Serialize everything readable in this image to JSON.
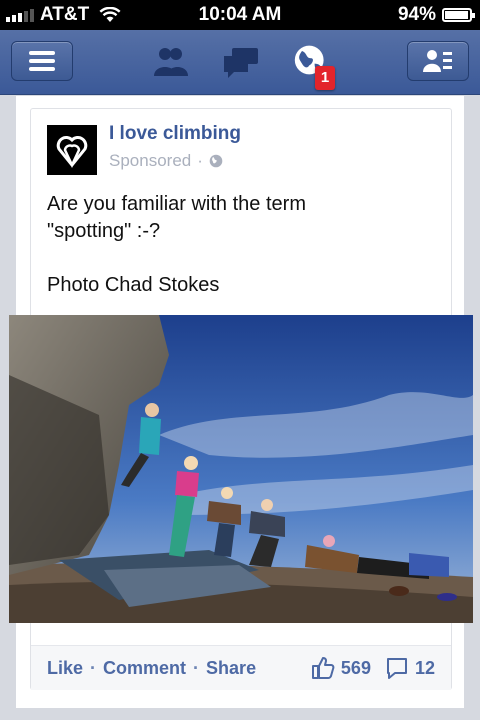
{
  "status": {
    "carrier": "AT&T",
    "time": "10:04 AM",
    "battery": "94%",
    "battery_level": 0.94
  },
  "nav": {
    "notifications_badge": "1",
    "icons": [
      "menu-icon",
      "friend-requests-icon",
      "messages-icon",
      "notifications-globe-icon",
      "profile-list-icon"
    ]
  },
  "post": {
    "page_name": "I love climbing",
    "sponsored": "Sponsored",
    "text": "Are you familiar with the term\n\"spotting\" :-?\n\nPhoto Chad Stokes",
    "likes": "569",
    "comments": "12"
  },
  "actions": {
    "like": "Like",
    "comment": "Comment",
    "share": "Share",
    "separator": "·"
  },
  "colors": {
    "brand": "#3b5998",
    "badge": "#e3242b",
    "link": "#4e6aa5"
  }
}
